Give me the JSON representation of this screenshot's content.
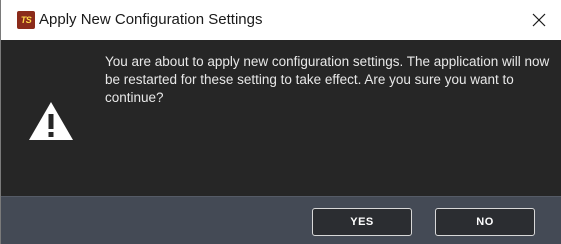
{
  "window": {
    "title": "Apply New Configuration Settings",
    "app_icon_text": "TS"
  },
  "icons": {
    "app": "ts-app-icon",
    "close": "close-icon",
    "warning": "warning-icon"
  },
  "dialog": {
    "message": "You are about to apply new configuration settings. The application will now be restarted for these setting to take effect. Are you sure you want to continue?"
  },
  "buttons": {
    "yes_label": "YES",
    "no_label": "NO"
  },
  "colors": {
    "titlebar": "#ffffff",
    "content_bg": "#262626",
    "footer_bg": "#444a55",
    "button_bg": "#2b2d31",
    "button_border": "#d8d8d8",
    "text": "#e8e8e8"
  }
}
